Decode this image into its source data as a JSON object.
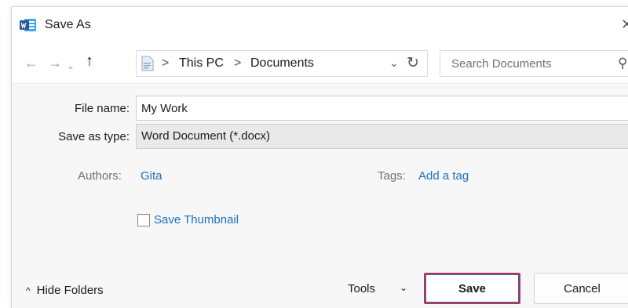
{
  "window": {
    "title": "Save As",
    "close_glyph": "✕"
  },
  "nav": {
    "back_glyph": "←",
    "forward_glyph": "→",
    "recent_glyph": "⌄",
    "up_glyph": "↑",
    "breadcrumbs": [
      "This PC",
      "Documents"
    ],
    "separator": ">",
    "dropdown_glyph": "⌄",
    "refresh_glyph": "↻"
  },
  "search": {
    "placeholder": "Search Documents",
    "icon_glyph": "⚲"
  },
  "form": {
    "file_name_label": "File name:",
    "file_name_value": "My Work",
    "save_type_label": "Save as type:",
    "save_type_value": "Word Document (*.docx)",
    "authors_label": "Authors:",
    "authors_value": "Gita",
    "tags_label": "Tags:",
    "tags_value": "Add a tag",
    "thumbnail_label": "Save Thumbnail"
  },
  "footer": {
    "hide_folders_glyph": "^",
    "hide_folders_label": "Hide Folders",
    "tools_label": "Tools",
    "tools_glyph": "⌄",
    "save_label": "Save",
    "cancel_label": "Cancel"
  },
  "colors": {
    "accent_link": "#1a6fc4",
    "save_highlight": "#c4304a",
    "word_blue": "#2b579a"
  },
  "icons": {
    "app": "word-app-icon",
    "folder": "document-folder-icon",
    "search": "search-icon",
    "refresh": "refresh-icon"
  }
}
